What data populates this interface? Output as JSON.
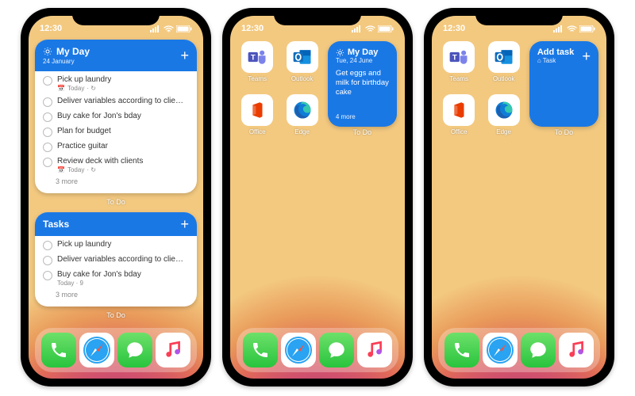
{
  "status": {
    "time": "12:30"
  },
  "phone1": {
    "widget_myDay": {
      "title": "My Day",
      "subtitle": "24 January",
      "tasks": [
        {
          "title": "Pick up laundry",
          "meta": "Today"
        },
        {
          "title": "Deliver variables according to clie…",
          "meta": ""
        },
        {
          "title": "Buy cake for Jon's bday",
          "meta": ""
        },
        {
          "title": "Plan for budget",
          "meta": ""
        },
        {
          "title": "Practice guitar",
          "meta": ""
        },
        {
          "title": "Review deck with clients",
          "meta": "Today"
        }
      ],
      "more": "3 more",
      "caption": "To Do"
    },
    "widget_tasks": {
      "title": "Tasks",
      "tasks": [
        {
          "title": "Pick up laundry",
          "meta": ""
        },
        {
          "title": "Deliver variables according to clie…",
          "meta": ""
        },
        {
          "title": "Buy cake for Jon's bday",
          "meta": "Today · 9"
        }
      ],
      "more": "3 more",
      "caption": "To Do"
    }
  },
  "phone2": {
    "apps": {
      "a1": "Teams",
      "a2": "Outlook",
      "a3": "Office",
      "a4": "Edge"
    },
    "widget": {
      "title": "My Day",
      "subtitle": "Tue, 24 June",
      "body": "Get eggs and milk for birthday cake",
      "footer": "4 more",
      "caption": "To Do"
    }
  },
  "phone3": {
    "apps": {
      "a1": "Teams",
      "a2": "Outlook",
      "a3": "Office",
      "a4": "Edge"
    },
    "widget": {
      "title": "Add task",
      "subtitle": "Task",
      "caption": "To Do"
    }
  },
  "dock": {
    "a1": "phone-icon",
    "a2": "safari-icon",
    "a3": "messages-icon",
    "a4": "music-icon"
  }
}
